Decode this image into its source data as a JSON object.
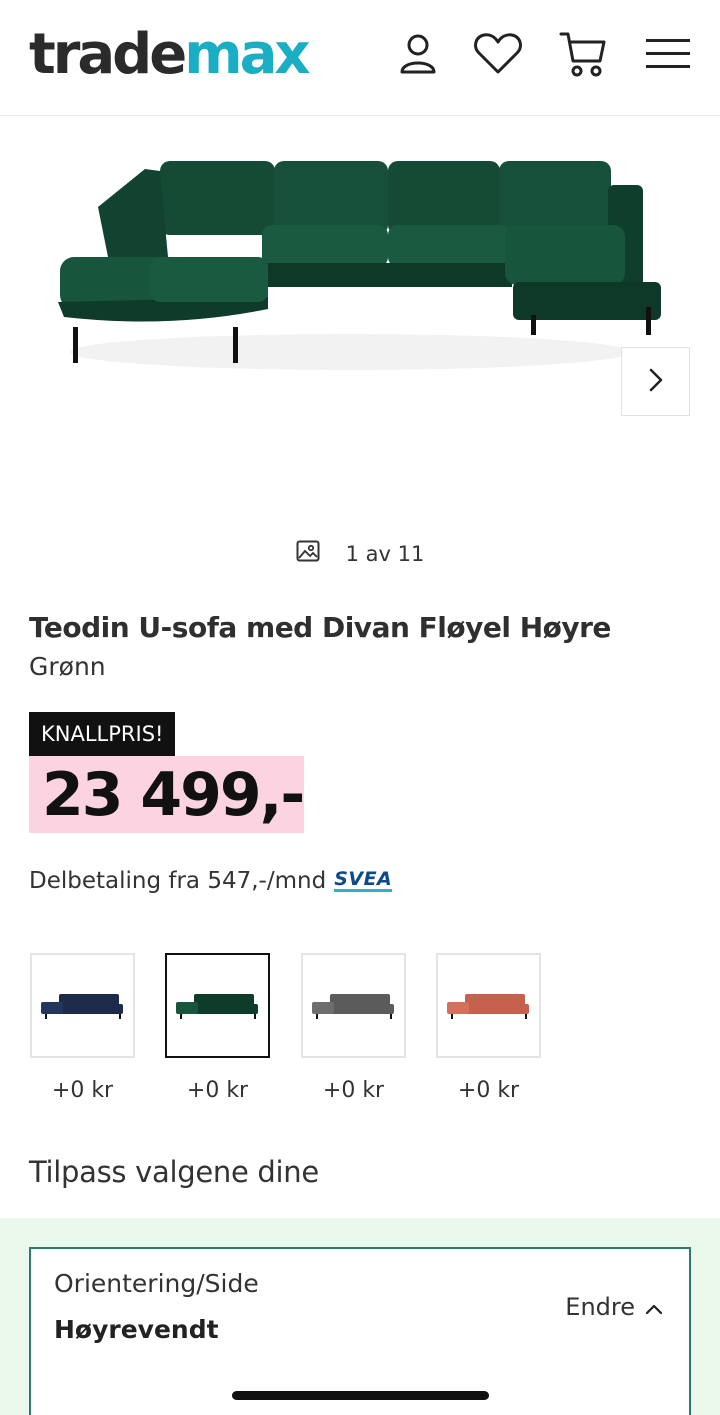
{
  "header": {
    "logo_part1": "trade",
    "logo_part2": "max",
    "icons": [
      "user-icon",
      "heart-icon",
      "cart-icon",
      "menu-icon"
    ]
  },
  "gallery": {
    "counter": "1 av 11",
    "next_icon": "chevron-right-icon"
  },
  "product": {
    "title": "Teodin U-sofa med Divan Fløyel Høyre",
    "variant": "Grønn",
    "badge": "KNALLPRIS!",
    "price": "23 499,-",
    "finance_text": "Delbetaling fra 547,-/mnd",
    "finance_brand": "SVEA"
  },
  "swatches": [
    {
      "color": "#1c2b4a",
      "price": "+0 kr",
      "selected": false
    },
    {
      "color": "#0f3b2a",
      "price": "+0 kr",
      "selected": true
    },
    {
      "color": "#5b5b5b",
      "price": "+0 kr",
      "selected": false
    },
    {
      "color": "#c6614e",
      "price": "+0 kr",
      "selected": false
    }
  ],
  "customize": {
    "heading": "Tilpass valgene dine",
    "option_label": "Orientering/Side",
    "option_value": "Høyrevendt",
    "edit_label": "Endre"
  },
  "colors": {
    "brand_teal": "#19aec3",
    "price_bg": "#fcd3e1",
    "sofa_green": "#0f3b2a",
    "card_border": "#2f7a6b",
    "area_bg": "#ebf8ec"
  }
}
